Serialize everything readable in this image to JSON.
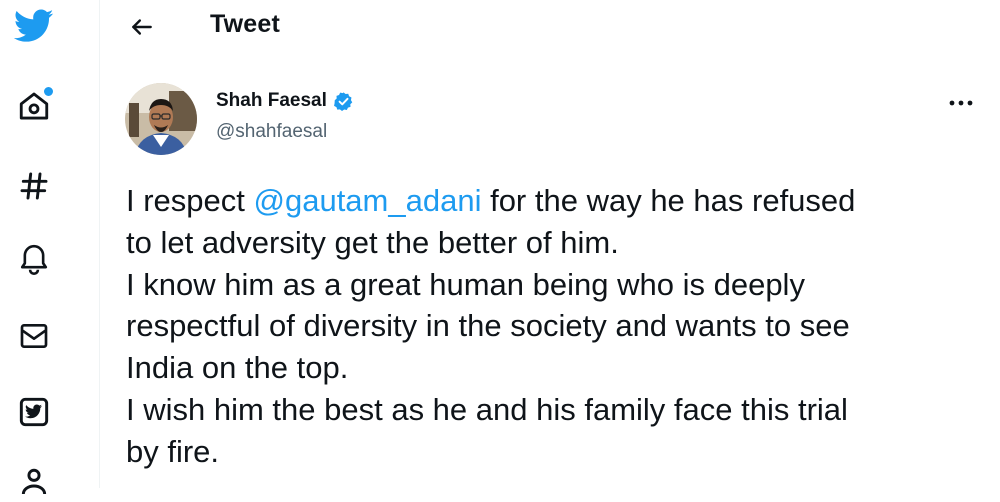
{
  "header": {
    "back_icon": "arrow-left-icon",
    "title": "Tweet"
  },
  "sidebar": {
    "items": [
      {
        "name": "twitter-logo-icon",
        "interactable": true
      },
      {
        "name": "home-icon",
        "interactable": true,
        "notification_dot": true
      },
      {
        "name": "explore-hashtag-icon",
        "interactable": true
      },
      {
        "name": "notifications-bell-icon",
        "interactable": true
      },
      {
        "name": "messages-envelope-icon",
        "interactable": true
      },
      {
        "name": "twitter-blue-icon",
        "interactable": true
      },
      {
        "name": "profile-icon",
        "interactable": true
      }
    ]
  },
  "tweet": {
    "author": {
      "name": "Shah Faesal",
      "handle": "@shahfaesal",
      "verified": true
    },
    "more_icon": "more-horizontal-icon",
    "text": {
      "part1": "I respect ",
      "mention": "@gautam_adani",
      "part2": " for the way he has refused\nto let adversity get the better of him.\nI know him as a great human being who is deeply\nrespectful of diversity in the society and wants to see\nIndia on the top.\nI wish him the best as he and his family face this trial\nby fire."
    }
  },
  "colors": {
    "accent": "#1d9bf0",
    "text": "#0f1419",
    "muted": "#536471"
  }
}
